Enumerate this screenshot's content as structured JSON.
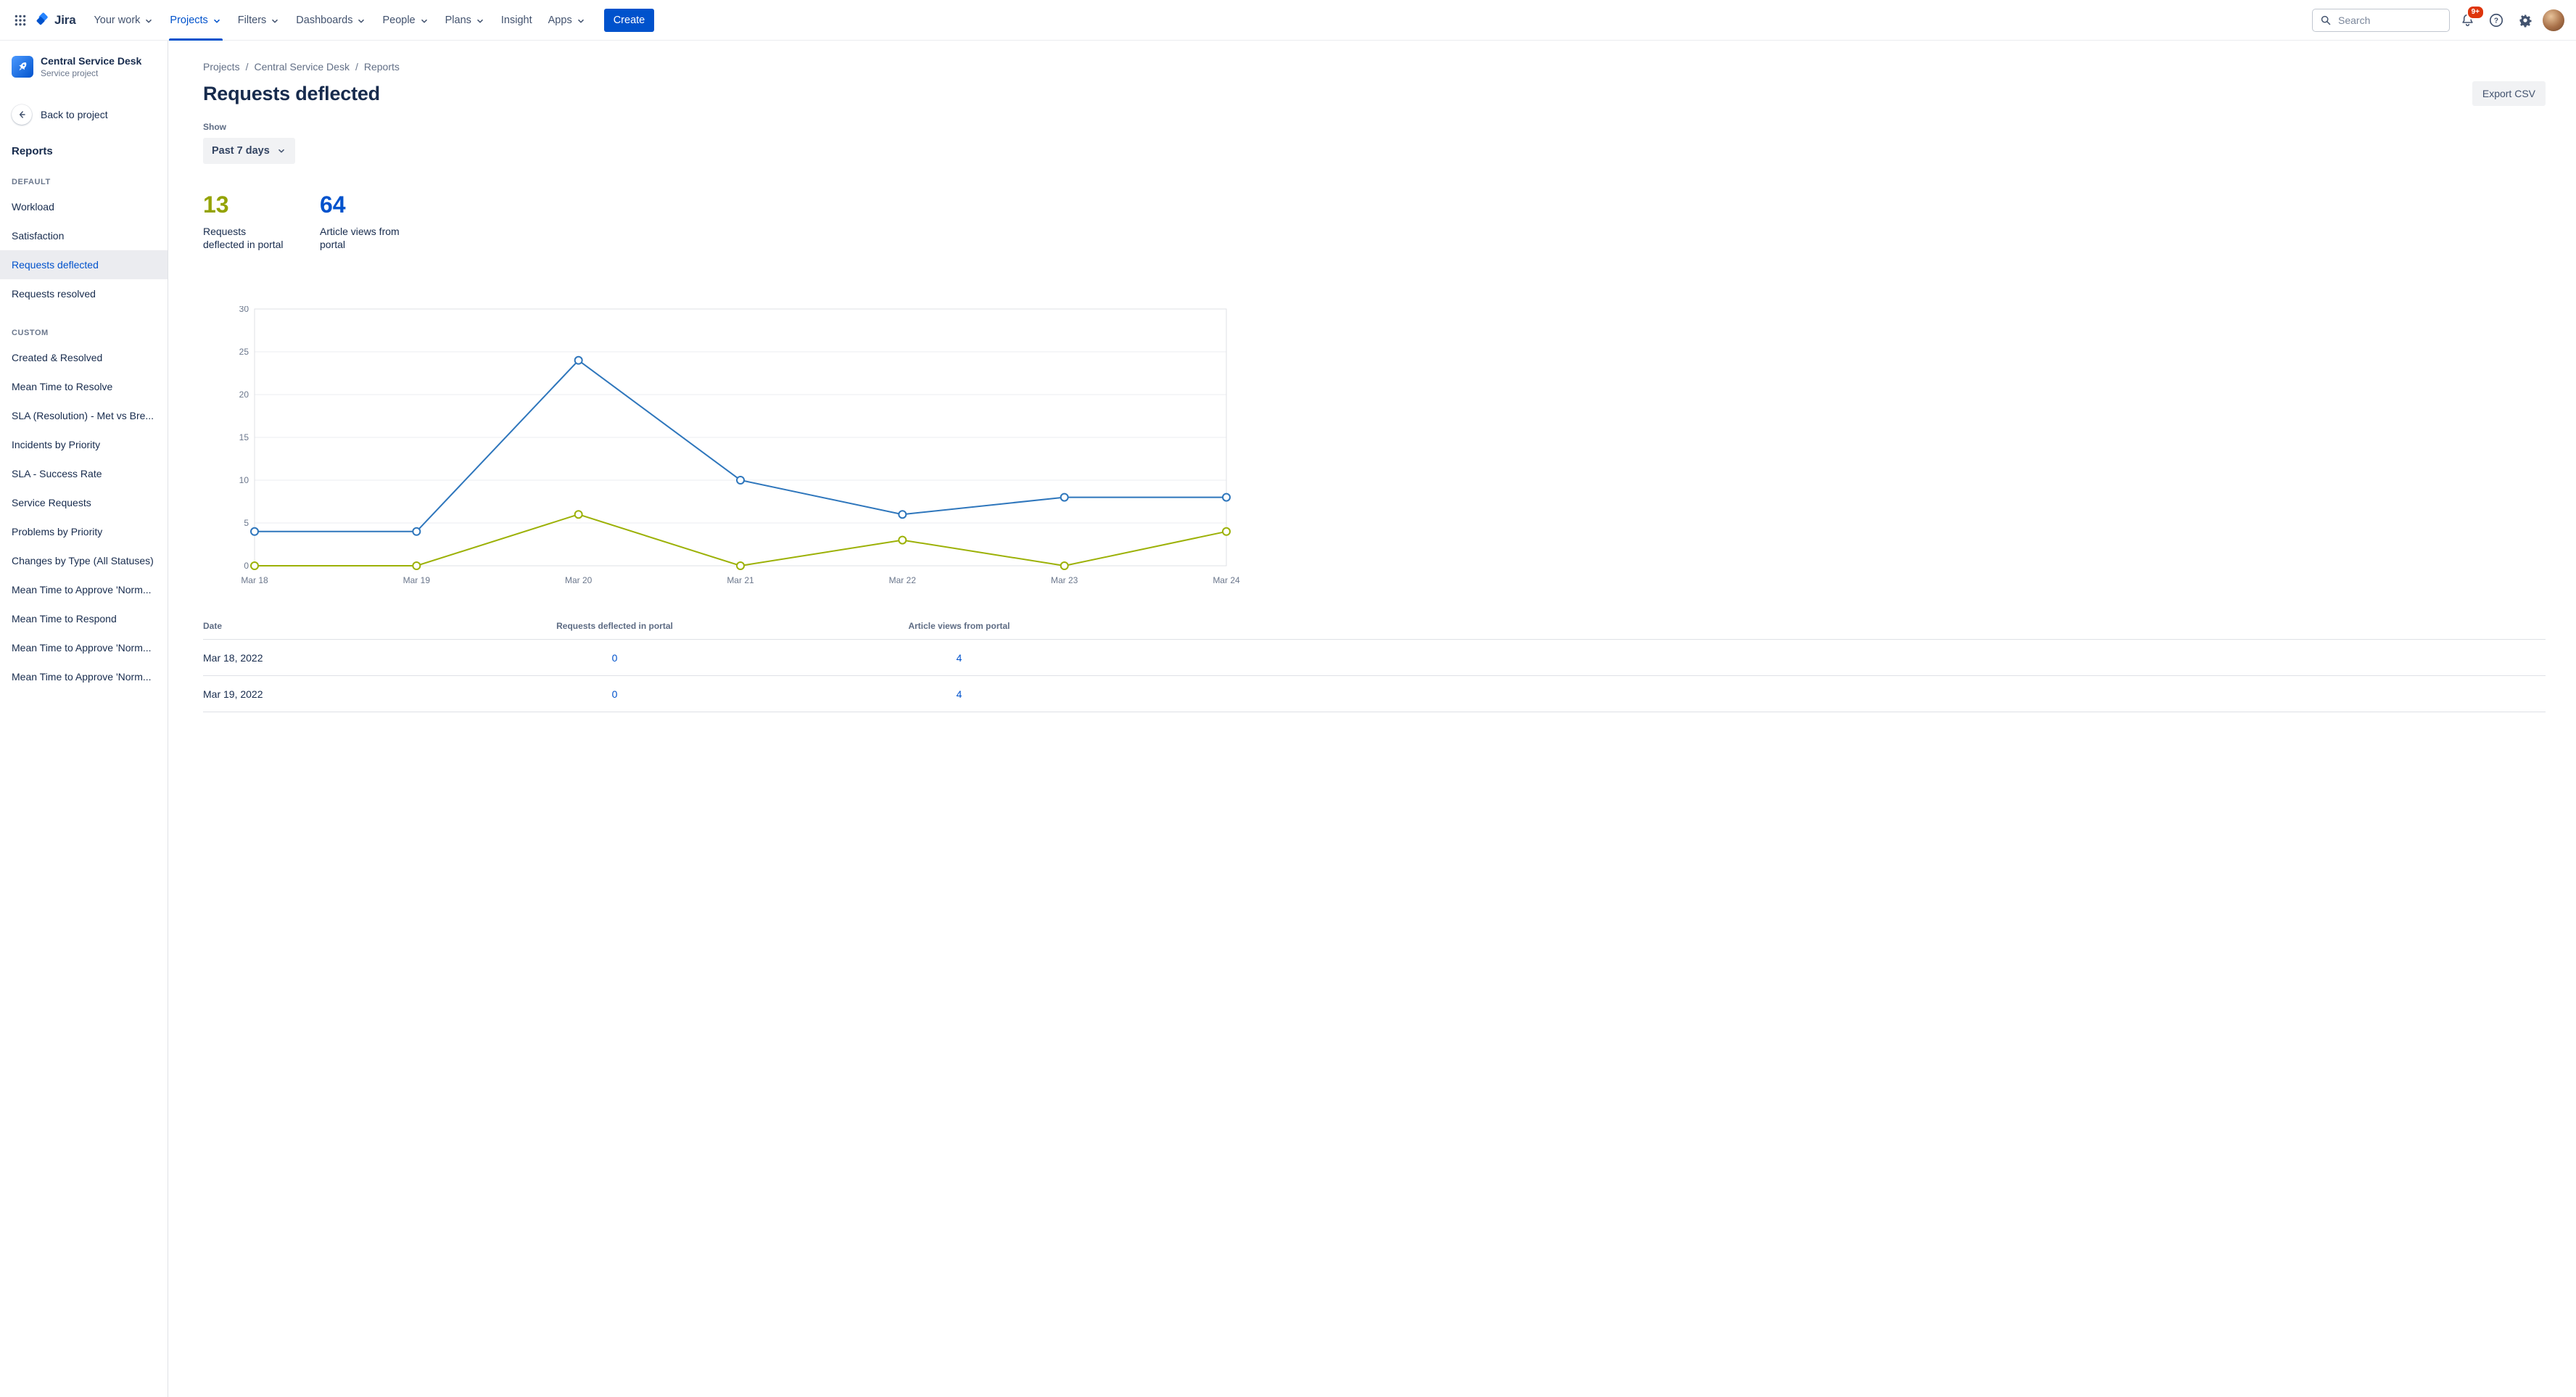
{
  "topbar": {
    "logo_text": "Jira",
    "nav": [
      {
        "label": "Your work",
        "chevron": true,
        "active": false
      },
      {
        "label": "Projects",
        "chevron": true,
        "active": true
      },
      {
        "label": "Filters",
        "chevron": true,
        "active": false
      },
      {
        "label": "Dashboards",
        "chevron": true,
        "active": false
      },
      {
        "label": "People",
        "chevron": true,
        "active": false
      },
      {
        "label": "Plans",
        "chevron": true,
        "active": false
      },
      {
        "label": "Insight",
        "chevron": false,
        "active": false
      },
      {
        "label": "Apps",
        "chevron": true,
        "active": false
      }
    ],
    "create_label": "Create",
    "search_placeholder": "Search",
    "notification_badge": "9+"
  },
  "colors": {
    "brand_blue": "#0052CC",
    "chart_blue": "#2E76BC",
    "chart_green": "#9CB106",
    "stat_green": "#94A302",
    "badge_red": "#DE350B",
    "selected_bg": "#EBECF0"
  },
  "sidebar": {
    "project_name": "Central Service Desk",
    "project_type": "Service project",
    "back_label": "Back to project",
    "section_title": "Reports",
    "groups": {
      "default": {
        "label": "DEFAULT",
        "items": [
          {
            "label": "Workload"
          },
          {
            "label": "Satisfaction"
          },
          {
            "label": "Requests deflected",
            "selected": true
          },
          {
            "label": "Requests resolved"
          }
        ]
      },
      "custom": {
        "label": "CUSTOM",
        "items": [
          {
            "label": "Created & Resolved"
          },
          {
            "label": "Mean Time to Resolve"
          },
          {
            "label": "SLA (Resolution) - Met vs Bre..."
          },
          {
            "label": "Incidents by Priority"
          },
          {
            "label": "SLA - Success Rate"
          },
          {
            "label": "Service Requests"
          },
          {
            "label": "Problems by Priority"
          },
          {
            "label": "Changes by Type (All Statuses)"
          },
          {
            "label": "Mean Time to Approve 'Norm..."
          },
          {
            "label": "Mean Time to Respond"
          },
          {
            "label": "Mean Time to Approve 'Norm..."
          },
          {
            "label": "Mean Time to Approve 'Norm..."
          }
        ]
      }
    }
  },
  "main": {
    "breadcrumbs": [
      "Projects",
      "Central Service Desk",
      "Reports"
    ],
    "title": "Requests deflected",
    "export_label": "Export CSV",
    "show_label": "Show",
    "range_value": "Past 7 days",
    "stats": [
      {
        "value": "13",
        "label": "Requests deflected in portal",
        "color": "#94A302"
      },
      {
        "value": "64",
        "label": "Article views from portal",
        "color": "#0052CC"
      }
    ]
  },
  "chart_data": {
    "type": "line",
    "title": "Requests deflected",
    "x": [
      "Mar 18",
      "Mar 19",
      "Mar 20",
      "Mar 21",
      "Mar 22",
      "Mar 23",
      "Mar 24"
    ],
    "series": [
      {
        "name": "Article views from portal",
        "color": "#2E76BC",
        "values": [
          4,
          4,
          24,
          10,
          6,
          8,
          8
        ]
      },
      {
        "name": "Requests deflected in portal",
        "color": "#9CB106",
        "values": [
          0,
          0,
          6,
          0,
          3,
          0,
          4
        ]
      }
    ],
    "ylim": [
      0,
      30
    ],
    "yticks": [
      0,
      5,
      10,
      15,
      20,
      25,
      30
    ],
    "grid": true,
    "legend": "none"
  },
  "table": {
    "columns": [
      "Date",
      "Requests deflected in portal",
      "Article views from portal"
    ],
    "rows": [
      {
        "date": "Mar 18, 2022",
        "deflected": "0",
        "views": "4"
      },
      {
        "date": "Mar 19, 2022",
        "deflected": "0",
        "views": "4"
      }
    ]
  }
}
